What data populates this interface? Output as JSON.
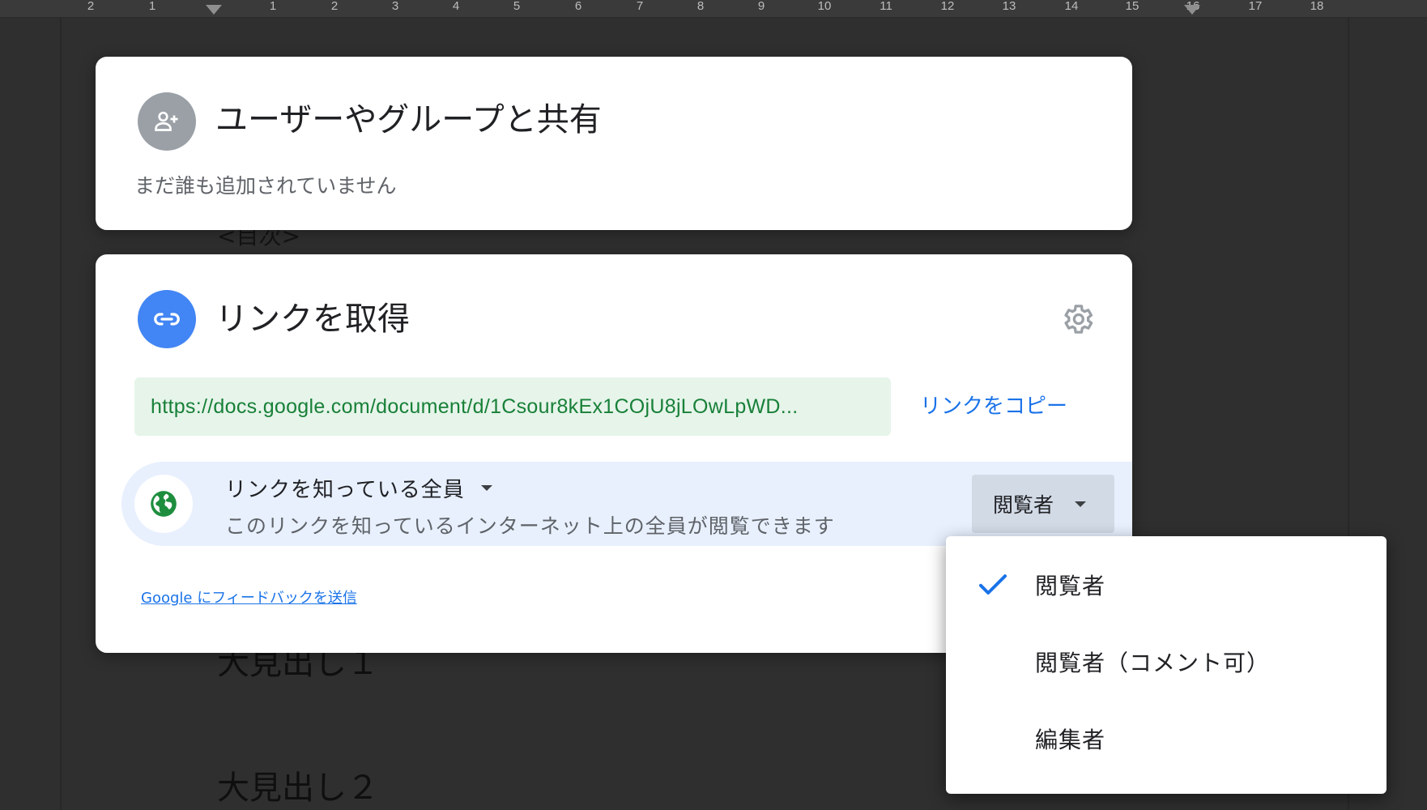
{
  "background_document": {
    "ruler_numbers": [
      "2",
      "1",
      "",
      "1",
      "2",
      "3",
      "4",
      "5",
      "6",
      "7",
      "8",
      "9",
      "10",
      "11",
      "12",
      "13",
      "14",
      "15",
      "16",
      "17",
      "18"
    ],
    "toc_text": "<目次>",
    "heading1": "大見出し１",
    "heading2": "大見出し２"
  },
  "share_with_people": {
    "title": "ユーザーやグループと共有",
    "empty_message": "まだ誰も追加されていません",
    "icon": "person-add-icon"
  },
  "get_link": {
    "title": "リンクを取得",
    "icon": "link-icon",
    "settings_icon": "gear-icon",
    "url": "https://docs.google.com/document/d/1Csour8kEx1COjU8jLOwLpWD...",
    "copy_link_label": "リンクをコピー",
    "access": {
      "scope_label": "リンクを知っている全員",
      "description": "このリンクを知っているインターネット上の全員が閲覧できます",
      "icon": "globe-icon",
      "role_label": "閲覧者"
    },
    "feedback_label": "Google にフィードバックを送信"
  },
  "role_menu": {
    "items": [
      {
        "label": "閲覧者",
        "selected": true
      },
      {
        "label": "閲覧者（コメント可）",
        "selected": false
      },
      {
        "label": "編集者",
        "selected": false
      }
    ]
  },
  "colors": {
    "accent_blue": "#1a73e8",
    "link_green": "#188038",
    "url_bg": "#e6f4ea",
    "access_row_bg": "#e8f0fe",
    "link_icon_bg": "#4285f4",
    "share_icon_bg": "#9aa0a6",
    "globe_green": "#1e8e3e"
  }
}
